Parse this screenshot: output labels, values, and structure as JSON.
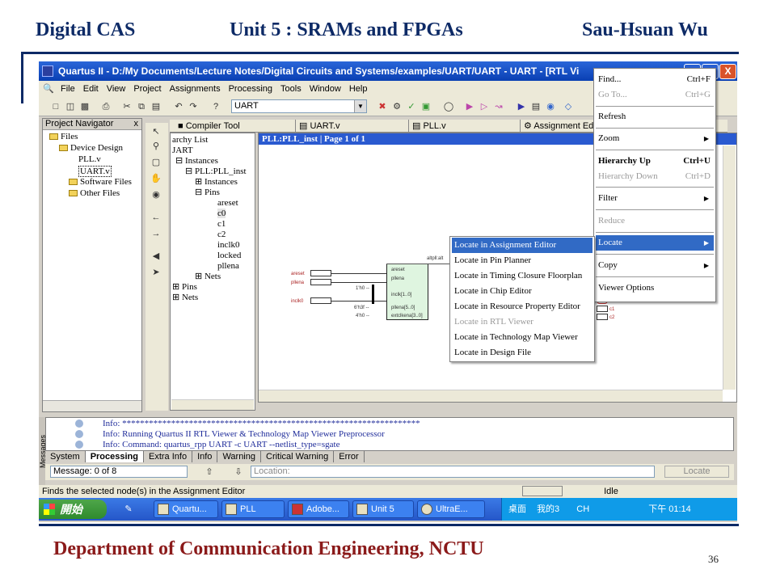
{
  "slide": {
    "header_left": "Digital CAS",
    "header_center": "Unit 5 : SRAMs and FPGAs",
    "header_right": "Sau-Hsuan Wu",
    "footer": "Department of Communication Engineering, NCTU",
    "page_number": "36"
  },
  "colors": {
    "heading": "#0d2a66",
    "footer": "#8b1a1a",
    "titlebar": "#0a3fb3",
    "menu_highlight": "#316ac5"
  },
  "window": {
    "title": "Quartus II - D:/My Documents/Lecture Notes/Digital Circuits and Systems/examples/UART/UART - UART - [RTL Vi",
    "controls": [
      "_",
      "□",
      "X"
    ]
  },
  "menubar": [
    "File",
    "Edit",
    "View",
    "Project",
    "Assignments",
    "Processing",
    "Tools",
    "Window",
    "Help"
  ],
  "toolbar": {
    "entity_combo": "UART"
  },
  "navigator": {
    "title": "Project Navigator",
    "items": [
      "Files",
      "Device Design",
      "PLL.v",
      "UART.v",
      "Software Files",
      "Other Files"
    ],
    "close": "x"
  },
  "hierarchy": {
    "items": [
      "archy List",
      "JART",
      "Instances",
      "PLL:PLL_inst",
      "Instances",
      "Pins",
      "areset",
      "c0",
      "c1",
      "c2",
      "inclk0",
      "locked",
      "pllena",
      "Nets",
      "Pins",
      "Nets"
    ]
  },
  "doc_tabs": [
    "Compiler Tool",
    "UART.v",
    "PLL.v",
    "Assignment Edi"
  ],
  "schematic": {
    "title": "PLL:PLL_inst | Page 1 of 1",
    "block_label": "altpll:alt",
    "inputs": [
      "areset",
      "pllena",
      "inclk0"
    ],
    "port_labels": [
      "areset",
      "pllena",
      "inclk[1..0]",
      "pllena[5..0]",
      "extclkena[3..0]"
    ],
    "const_labels": [
      "1'h0 --",
      "6'h3f --",
      "4'h0 --"
    ],
    "outputs": [
      "c0",
      "c1",
      "c2"
    ]
  },
  "locate_submenu": [
    "Locate in Assignment Editor",
    "Locate in Pin Planner",
    "Locate in Timing Closure Floorplan",
    "Locate in Chip Editor",
    "Locate in Resource Property Editor",
    "Locate in RTL Viewer",
    "Locate in Technology Map Viewer",
    "Locate in Design File"
  ],
  "context_menu": [
    {
      "label": "Find...",
      "shortcut": "Ctrl+F"
    },
    {
      "label": "Go To...",
      "shortcut": "Ctrl+G"
    },
    {
      "label": "Refresh",
      "shortcut": ""
    },
    {
      "label": "Zoom",
      "shortcut": ""
    },
    {
      "label": "Hierarchy Up",
      "shortcut": "Ctrl+U"
    },
    {
      "label": "Hierarchy Down",
      "shortcut": "Ctrl+D"
    },
    {
      "label": "Filter",
      "shortcut": ""
    },
    {
      "label": "Reduce",
      "shortcut": ""
    },
    {
      "label": "Locate",
      "shortcut": ""
    },
    {
      "label": "Copy",
      "shortcut": ""
    },
    {
      "label": "Viewer Options",
      "shortcut": ""
    }
  ],
  "messages": {
    "lines": [
      "Info: *******************************************************************",
      "Info: Running Quartus II RTL Viewer & Technology Map Viewer Preprocessor",
      "Info: Command: quartus_rpp UART -c UART --netlist_type=sgate"
    ],
    "side_label": "Messages",
    "tabs": [
      "System",
      "Processing",
      "Extra Info",
      "Info",
      "Warning",
      "Critical Warning",
      "Error"
    ],
    "count_label": "Message: 0 of 8",
    "location_label": "Location:",
    "locate_button": "Locate"
  },
  "statusbar": {
    "text": "Finds the selected node(s) in the Assignment Editor",
    "state": "Idle"
  },
  "taskbar": {
    "start": "開始",
    "buttons": [
      "Quartu...",
      "PLL",
      "Adobe...",
      "Unit 5",
      "UltraE..."
    ],
    "tray_desktop": "桌面",
    "tray_item": "我的3",
    "tray_lang": "CH",
    "clock": "下午 01:14"
  }
}
